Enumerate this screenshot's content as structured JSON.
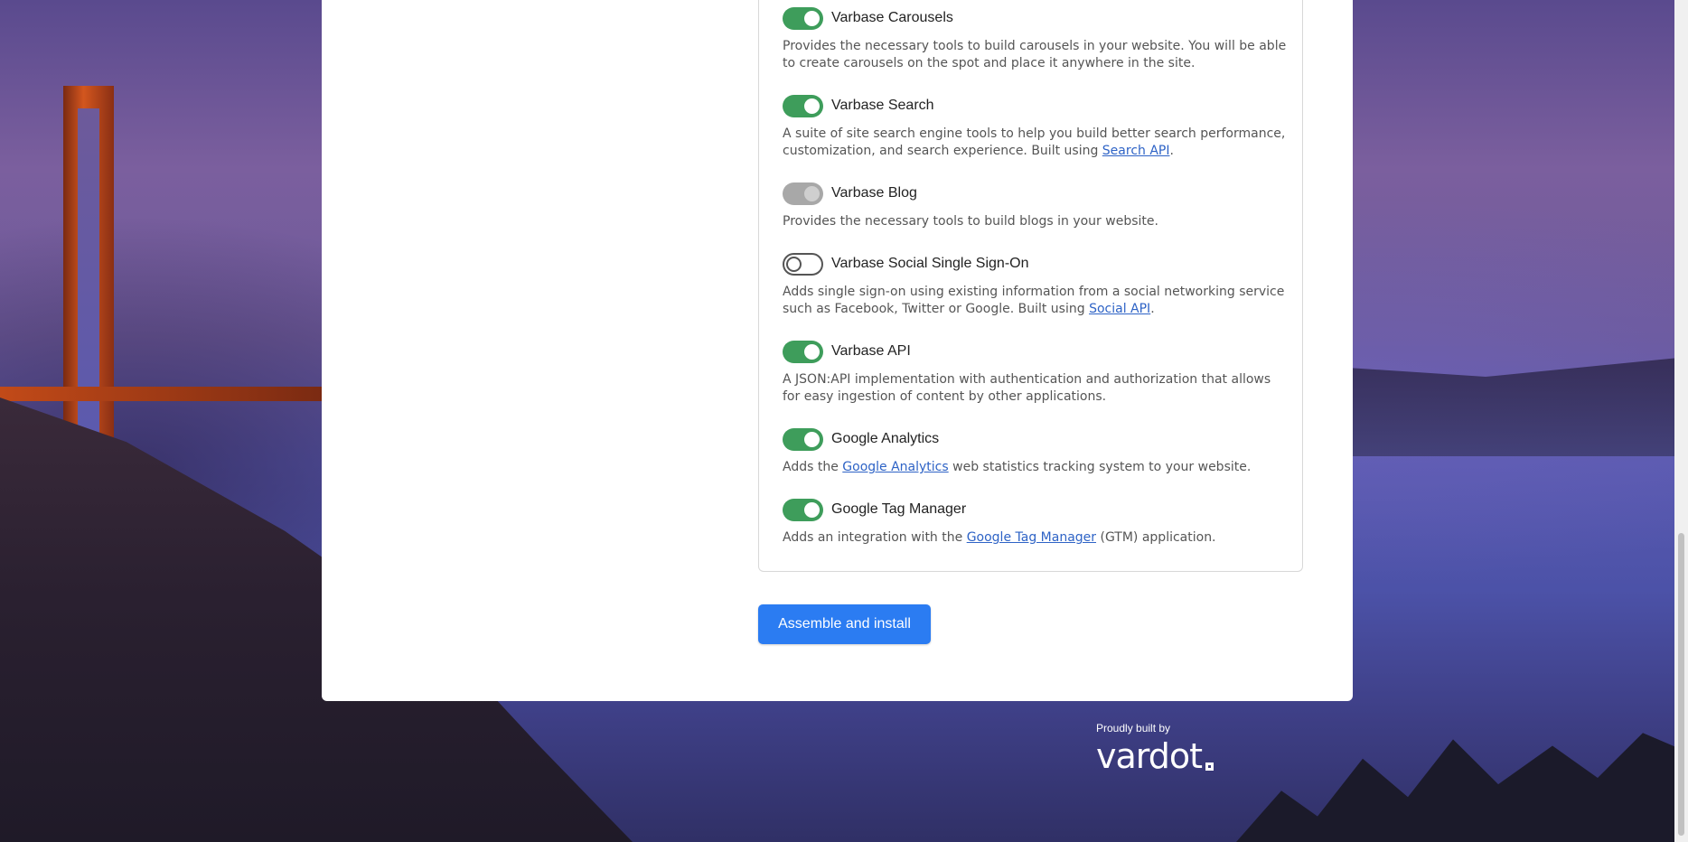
{
  "features": [
    {
      "title": "Varbase Carousels",
      "state": "on",
      "desc_parts": [
        "Provides the necessary tools to build carousels in your website. You will be able to create carousels on the spot and place it anywhere in the site."
      ],
      "link": "",
      "desc_after": ""
    },
    {
      "title": "Varbase Search",
      "state": "on",
      "desc_parts": [
        "A suite of site search engine tools to help you build better search performance, customization, and search experience. Built using "
      ],
      "link": "Search API",
      "desc_after": "."
    },
    {
      "title": "Varbase Blog",
      "state": "disabled",
      "desc_parts": [
        "Provides the necessary tools to build blogs in your website."
      ],
      "link": "",
      "desc_after": ""
    },
    {
      "title": "Varbase Social Single Sign-On",
      "state": "off",
      "desc_parts": [
        "Adds single sign-on using existing information from a social networking service such as Facebook, Twitter or Google. Built using "
      ],
      "link": "Social API",
      "desc_after": "."
    },
    {
      "title": "Varbase API",
      "state": "on",
      "desc_parts": [
        "A JSON:API implementation with authentication and authorization that allows for easy ingestion of content by other applications."
      ],
      "link": "",
      "desc_after": ""
    },
    {
      "title": "Google Analytics",
      "state": "on",
      "desc_parts": [
        "Adds the "
      ],
      "link": "Google Analytics",
      "desc_after": " web statistics tracking system to your website."
    },
    {
      "title": "Google Tag Manager",
      "state": "on",
      "desc_parts": [
        "Adds an integration with the "
      ],
      "link": "Google Tag Manager",
      "desc_after": " (GTM) application."
    }
  ],
  "install_button": "Assemble and install",
  "footer": {
    "built_by": "Proudly built by",
    "brand": "vardot"
  },
  "colors": {
    "toggle_on": "#3e9d5b",
    "button": "#2b7cf2",
    "link": "#2e63c6"
  }
}
